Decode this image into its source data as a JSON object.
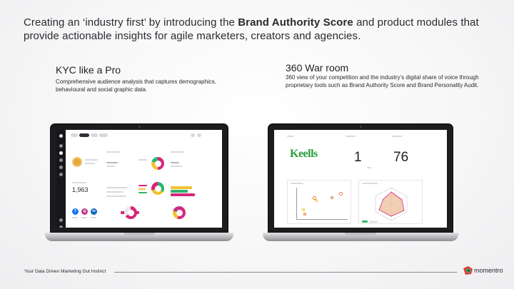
{
  "headline": {
    "prefix": "Creating an ‘industry first’ by introducing the ",
    "bold": "Brand Authority Score",
    "suffix": " and product modules that provide actionable insights for agile marketers, creators and agencies."
  },
  "kyc": {
    "title": "KYC like a Pro",
    "description": "Comprehensive audience analysis that captures demographics, behavioural and social graphic data.",
    "screen": {
      "follower_count": "1,963"
    }
  },
  "war_room": {
    "title": "360 War room",
    "description": "360 view of your competition and the industry’s digital share of voice through proprietary tools such as Brand Authority Score and Brand Personality Audit.",
    "screen": {
      "brand_logo_text": "Keells",
      "metric_1": "1",
      "metric_2": "76"
    }
  },
  "footer": {
    "tagline": "Your Data Driven Marketing Gut Instinct",
    "brand": "momentro"
  },
  "colors": {
    "donut_magenta": "#d6267c",
    "donut_yellow": "#f2c230",
    "donut_green": "#2fb56a",
    "keells_green": "#2a9d3a",
    "brand_red": "#e53a3a"
  }
}
